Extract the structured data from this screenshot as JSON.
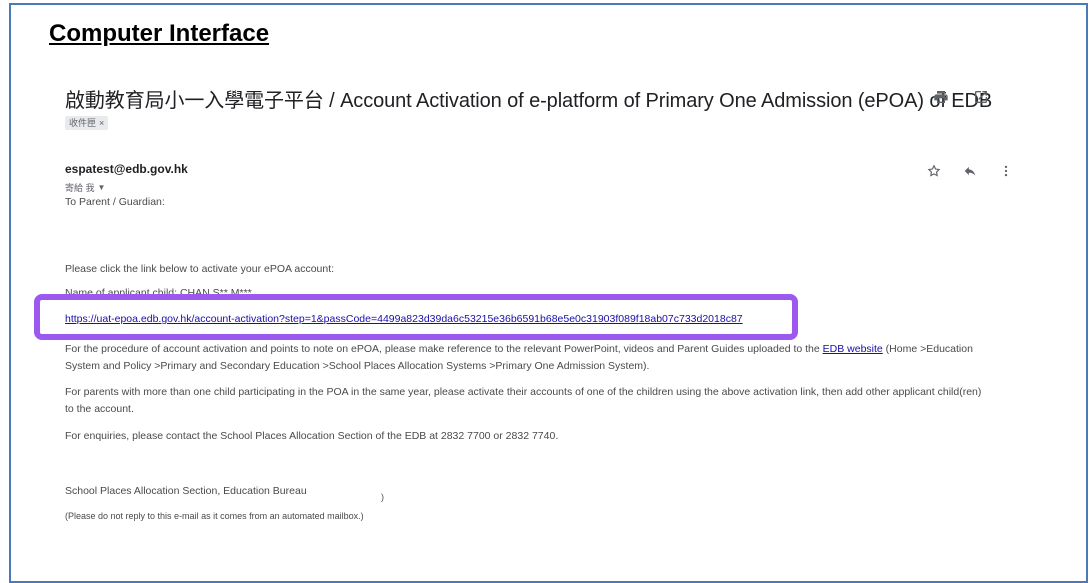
{
  "heading": "Computer Interface",
  "email": {
    "subject": "啟動教育局小一入學電子平台 / Account Activation of e-platform of Primary One Admission (ePOA) of EDB",
    "label_chip": "收件匣",
    "label_close": "×",
    "sender": "espatest@edb.gov.hk",
    "recipient": "寄給 我",
    "greeting": "To Parent / Guardian:",
    "instruction": "Please click the link below to activate your ePOA account:",
    "child_name": "Name of applicant child: CHAN S** M***",
    "activation_link": "https://uat-epoa.edb.gov.hk/account-activation?step=1&passCode=4499a823d39da6c53215e36b6591b68e5e0c31903f089f18ab07c733d2018c87",
    "procedure_before": "For the procedure of account activation and points to note on ePOA, please make reference to the relevant PowerPoint, videos and Parent Guides uploaded to the ",
    "edb_link": "EDB website",
    "procedure_after": " (Home >Education System and Policy >Primary and Secondary Education >School Places Allocation Systems >Primary One Admission System).",
    "parents_note": "For parents with more than one child participating in the POA in the same year, please activate their accounts of one of the children using the above activation link, then add other applicant child(ren) to the account.",
    "enquiries": "For enquiries, please contact the School Places Allocation Section of the EDB at 2832 7700 or 2832 7740.",
    "signature": "School Places Allocation Section, Education Bureau",
    "stray_mark": ")",
    "noreply": "(Please do not reply to this e-mail as it comes from an automated mailbox.)"
  },
  "icons": {
    "print": "print-icon",
    "open_new_window": "open-in-new-icon",
    "star": "star-icon",
    "reply": "reply-icon",
    "more": "more-vert-icon",
    "dropdown": "chevron-down-icon"
  },
  "colors": {
    "highlight_border": "#9b59f0",
    "link": "#1a0dab",
    "frame_border": "#4a7ab8"
  }
}
